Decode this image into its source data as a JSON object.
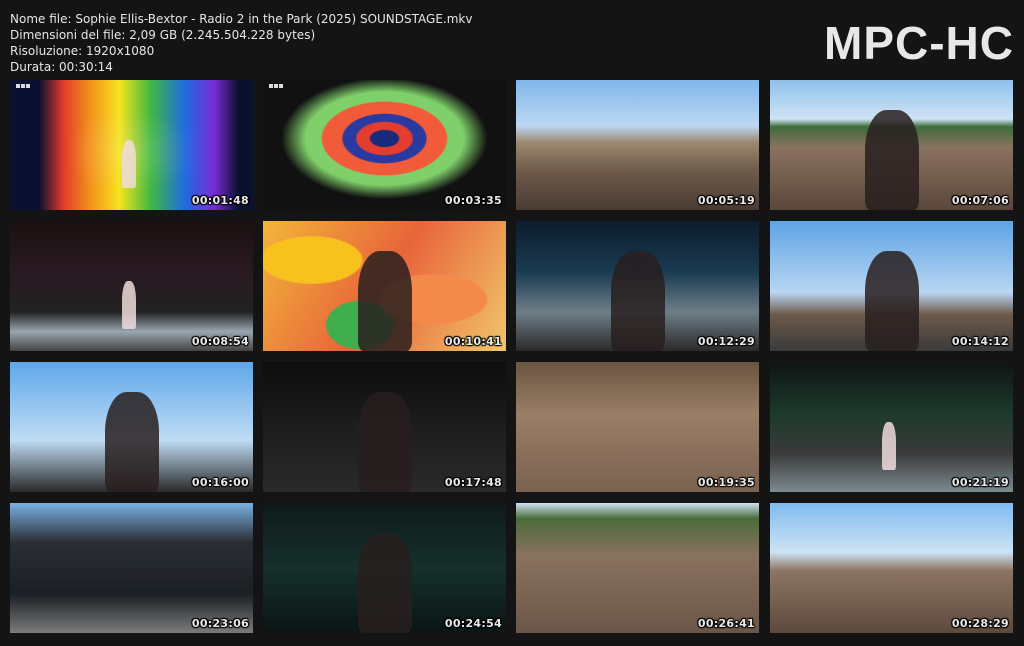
{
  "file_info": {
    "name": "Nome file: Sophie Ellis-Bextor - Radio 2 in the Park (2025) SOUNDSTAGE.mkv",
    "size": "Dimensioni del file: 2,09 GB (2.245.504.228 bytes)",
    "resolution": "Risoluzione: 1920x1080",
    "duration": "Durata: 00:30:14"
  },
  "logo": "MPC-HC",
  "thumbnails": [
    {
      "timestamp": "00:01:48",
      "scene": "s-rainbow",
      "bbc": true
    },
    {
      "timestamp": "00:03:35",
      "scene": "s-heart",
      "bbc": true
    },
    {
      "timestamp": "00:05:19",
      "scene": "s-crowd-sky",
      "bbc": false
    },
    {
      "timestamp": "00:07:06",
      "scene": "s-crowd-sky2",
      "bbc": false
    },
    {
      "timestamp": "00:08:54",
      "scene": "s-stage-dark",
      "bbc": false
    },
    {
      "timestamp": "00:10:41",
      "scene": "s-psych",
      "bbc": false
    },
    {
      "timestamp": "00:12:29",
      "scene": "s-stage-blue",
      "bbc": false
    },
    {
      "timestamp": "00:14:12",
      "scene": "s-sky-band",
      "bbc": false
    },
    {
      "timestamp": "00:16:00",
      "scene": "s-drummer",
      "bbc": false
    },
    {
      "timestamp": "00:17:48",
      "scene": "s-dark-stage2",
      "bbc": false
    },
    {
      "timestamp": "00:19:35",
      "scene": "s-crowd-close",
      "bbc": false
    },
    {
      "timestamp": "00:21:19",
      "scene": "s-green-stage",
      "bbc": false
    },
    {
      "timestamp": "00:23:06",
      "scene": "s-wide-stage",
      "bbc": false
    },
    {
      "timestamp": "00:24:54",
      "scene": "s-closeup",
      "bbc": false
    },
    {
      "timestamp": "00:26:41",
      "scene": "s-crowd-wide",
      "bbc": false
    },
    {
      "timestamp": "00:28:29",
      "scene": "s-crowd-flag",
      "bbc": false
    }
  ]
}
